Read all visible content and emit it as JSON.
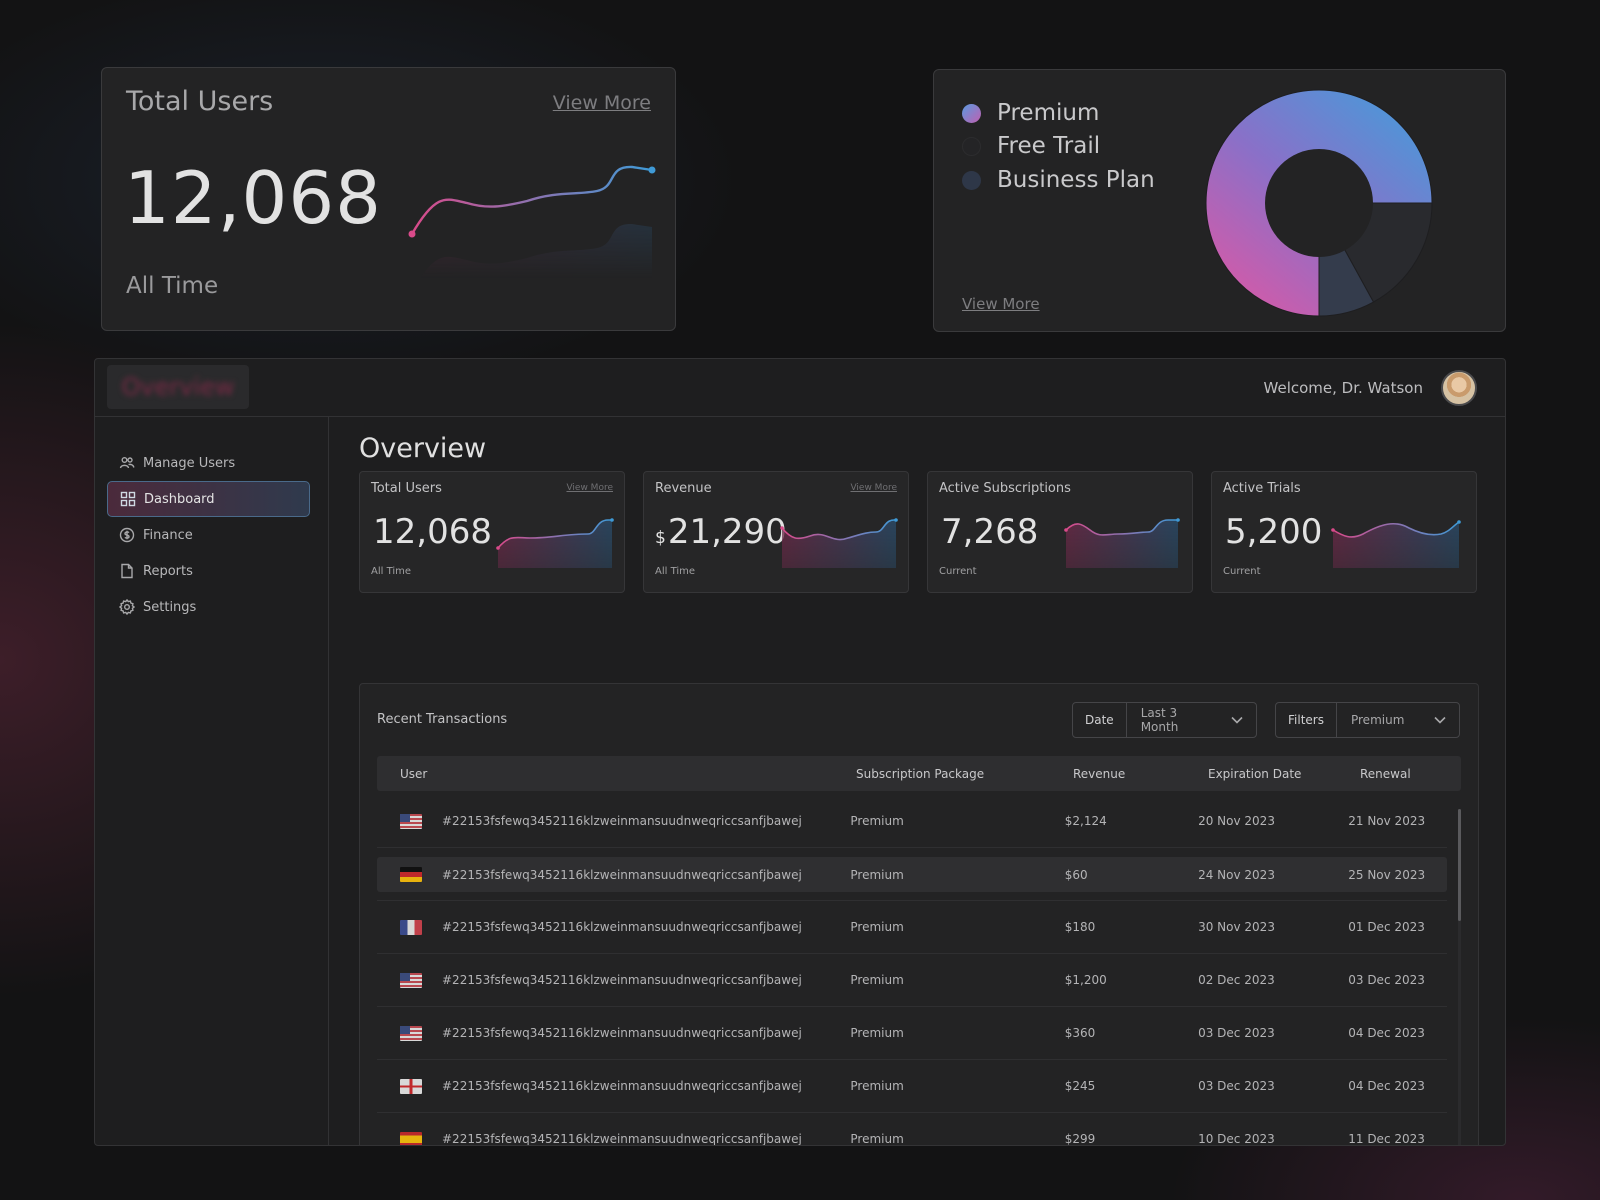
{
  "users_card": {
    "title": "Total Users",
    "link": "View More",
    "value": "12,068",
    "subtitle": "All Time"
  },
  "subscriptions_card": {
    "legend": [
      {
        "label": "Premium",
        "color": "#c060b0"
      },
      {
        "label": "Free Trail",
        "color": "#232324"
      },
      {
        "label": "Business Plan",
        "color": "#2e3748"
      }
    ],
    "link": "View More",
    "chart_data": {
      "type": "pie",
      "labels": [
        "Premium",
        "Free Trail",
        "Business Plan"
      ],
      "values": [
        75,
        17,
        8
      ]
    }
  },
  "app": {
    "logo_text": "Overview",
    "welcome": "Welcome, Dr. Watson"
  },
  "sidebar": {
    "items": [
      {
        "label": "Manage Users",
        "icon": "users-icon"
      },
      {
        "label": "Dashboard",
        "icon": "grid-icon"
      },
      {
        "label": "Finance",
        "icon": "dollar-icon"
      },
      {
        "label": "Reports",
        "icon": "document-icon"
      },
      {
        "label": "Settings",
        "icon": "gear-icon"
      }
    ]
  },
  "page": {
    "title": "Overview"
  },
  "stats": [
    {
      "title": "Total Users",
      "link": "View More",
      "currency": "",
      "value": "12,068",
      "sub": "All Time"
    },
    {
      "title": "Revenue",
      "link": "View More",
      "currency": "$",
      "value": "21,290",
      "sub": "All Time"
    },
    {
      "title": "Active Subscriptions",
      "link": "",
      "currency": "",
      "value": "7,268",
      "sub": "Current"
    },
    {
      "title": "Active Trials",
      "link": "",
      "currency": "",
      "value": "5,200",
      "sub": "Current"
    }
  ],
  "transactions": {
    "title": "Recent Transactions",
    "date_filter": {
      "key": "Date",
      "value": "Last 3 Month"
    },
    "plan_filter": {
      "key": "Filters",
      "value": "Premium"
    },
    "columns": [
      "User",
      "Subscription Package",
      "Revenue",
      "Expiration Date",
      "Renewal"
    ],
    "rows": [
      {
        "flag": "us",
        "user": "#22153fsfewq3452116klzweinmansuudnweqriccsanfjbawej",
        "package": "Premium",
        "revenue": "$2,124",
        "expiration": "20 Nov 2023",
        "renewal": "21 Nov 2023"
      },
      {
        "flag": "de",
        "user": "#22153fsfewq3452116klzweinmansuudnweqriccsanfjbawej",
        "package": "Premium",
        "revenue": "$60",
        "expiration": "24 Nov 2023",
        "renewal": "25 Nov 2023"
      },
      {
        "flag": "fr",
        "user": "#22153fsfewq3452116klzweinmansuudnweqriccsanfjbawej",
        "package": "Premium",
        "revenue": "$180",
        "expiration": "30 Nov 2023",
        "renewal": "01 Dec 2023"
      },
      {
        "flag": "us",
        "user": "#22153fsfewq3452116klzweinmansuudnweqriccsanfjbawej",
        "package": "Premium",
        "revenue": "$1,200",
        "expiration": "02 Dec 2023",
        "renewal": "03 Dec 2023"
      },
      {
        "flag": "us",
        "user": "#22153fsfewq3452116klzweinmansuudnweqriccsanfjbawej",
        "package": "Premium",
        "revenue": "$360",
        "expiration": "03 Dec 2023",
        "renewal": "04 Dec 2023"
      },
      {
        "flag": "ge",
        "user": "#22153fsfewq3452116klzweinmansuudnweqriccsanfjbawej",
        "package": "Premium",
        "revenue": "$245",
        "expiration": "03 Dec 2023",
        "renewal": "04 Dec 2023"
      },
      {
        "flag": "es",
        "user": "#22153fsfewq3452116klzweinmansuudnweqriccsanfjbawej",
        "package": "Premium",
        "revenue": "$299",
        "expiration": "10 Dec 2023",
        "renewal": "11 Dec 2023"
      }
    ]
  }
}
